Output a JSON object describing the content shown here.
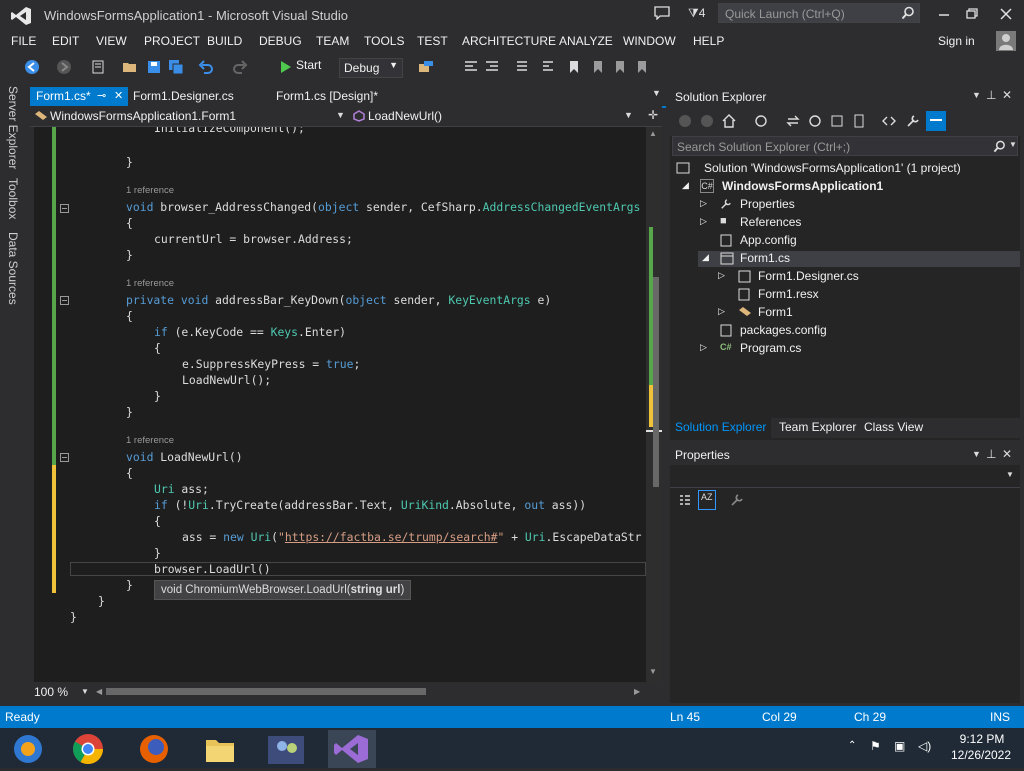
{
  "window": {
    "title": "WindowsFormsApplication1 - Microsoft Visual Studio",
    "notif_count": "4",
    "quick_launch_placeholder": "Quick Launch (Ctrl+Q)"
  },
  "menu": {
    "items": [
      "FILE",
      "EDIT",
      "VIEW",
      "PROJECT",
      "BUILD",
      "DEBUG",
      "TEAM",
      "TOOLS",
      "TEST",
      "ARCHITECTURE",
      "ANALYZE",
      "WINDOW",
      "HELP"
    ],
    "sign_in": "Sign in"
  },
  "toolbar": {
    "start_label": "Start",
    "config_value": "Debug"
  },
  "side_tabs": [
    "Server Explorer",
    "Toolbox",
    "Data Sources"
  ],
  "doc_tabs": [
    {
      "label": "Form1.cs*",
      "active": true
    },
    {
      "label": "Form1.Designer.cs",
      "active": false
    },
    {
      "label": "Form1.cs [Design]*",
      "active": false
    }
  ],
  "nav": {
    "class_dropdown": "WindowsFormsApplication1.Form1",
    "member_dropdown": "LoadNewUrl()"
  },
  "editor": {
    "reference_label": "1 reference",
    "lines": {
      "l1": "InitializeComponent();",
      "l2": "}",
      "l3_kw": "void",
      "l3_name": " browser_AddressChanged(",
      "l3_obj": "object",
      "l3_rest": " sender, CefSharp.",
      "l3_type": "AddressChangedEventArgs",
      "l4": "{",
      "l5": "currentUrl = browser.Address;",
      "l6": "}",
      "l7_kw1": "private",
      "l7_kw2": "void",
      "l7_name": " addressBar_KeyDown(",
      "l7_obj": "object",
      "l7_mid": " sender, ",
      "l7_type": "KeyEventArgs",
      "l7_end": " e)",
      "l8": "{",
      "l9_kw": "if",
      "l9_a": " (e.KeyCode == ",
      "l9_type": "Keys",
      "l9_b": ".Enter)",
      "l10": "{",
      "l11_a": "e.SuppressKeyPress = ",
      "l11_kw": "true",
      "l11_b": ";",
      "l12": "LoadNewUrl();",
      "l13": "}",
      "l14": "}",
      "l15_kw": "void",
      "l15_name": " LoadNewUrl()",
      "l16": "{",
      "l17_type": "Uri",
      "l17_rest": " ass;",
      "l18_kw": "if",
      "l18_a": " (!",
      "l18_type": "Uri",
      "l18_b": ".TryCreate(addressBar.Text, ",
      "l18_type2": "UriKind",
      "l18_c": ".Absolute, ",
      "l18_kw2": "out",
      "l18_d": " ass))",
      "l19": "{",
      "l20_a": "ass = ",
      "l20_kw": "new",
      "l20_type": " Uri",
      "l20_b": "(",
      "l20_q1": "\"",
      "l20_url": "https://factba.se/trump/search#",
      "l20_q2": "\"",
      "l20_c": " + ",
      "l20_type2": "Uri",
      "l20_d": ".EscapeDataStr",
      "l21": "}",
      "l22": "browser.LoadUrl()",
      "l23": "}",
      "l24": "}",
      "l25": "}"
    },
    "tooltip_prefix": "void ChromiumWebBrowser.LoadUrl(",
    "tooltip_param": "string url",
    "tooltip_suffix": ")",
    "zoom": "100 %"
  },
  "solution_explorer": {
    "title": "Solution Explorer",
    "search_placeholder": "Search Solution Explorer (Ctrl+;)",
    "tree": [
      "Solution 'WindowsFormsApplication1' (1 project)",
      "WindowsFormsApplication1",
      "Properties",
      "References",
      "App.config",
      "Form1.cs",
      "Form1.Designer.cs",
      "Form1.resx",
      "Form1",
      "packages.config",
      "Program.cs"
    ],
    "tabs": [
      "Solution Explorer",
      "Team Explorer",
      "Class View"
    ]
  },
  "properties": {
    "title": "Properties"
  },
  "status": {
    "ready": "Ready",
    "ln": "Ln 45",
    "col": "Col 29",
    "ch": "Ch 29",
    "ins": "INS"
  },
  "taskbar": {
    "time": "9:12 PM",
    "date": "12/26/2022"
  },
  "colors": {
    "accent": "#007acc",
    "keyword": "#569cd6",
    "type": "#4ec9b0",
    "string": "#d69d85",
    "taskbar": "#1f2a36"
  }
}
